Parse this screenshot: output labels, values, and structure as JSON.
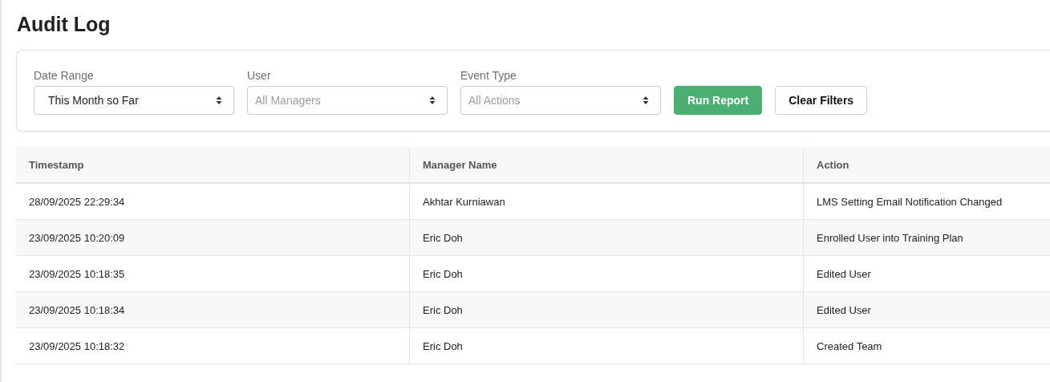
{
  "page": {
    "title": "Audit Log"
  },
  "filters": [
    {
      "label": "Date Range",
      "value": "This Month so Far"
    },
    {
      "label": "User",
      "placeholder": "All Managers"
    },
    {
      "label": "Event Type",
      "placeholder": "All Actions"
    }
  ],
  "buttons": [
    {
      "label": "Run Report",
      "kind": "primary"
    },
    {
      "label": "Clear Filters",
      "kind": "secondary"
    }
  ],
  "table": {
    "columns": [
      "Timestamp",
      "Manager Name",
      "Action"
    ],
    "rows": [
      [
        "28/09/2025 22:29:34",
        "Akhtar Kurniawan",
        "LMS Setting Email Notification Changed"
      ],
      [
        "23/09/2025 10:20:09",
        "Eric Doh",
        "Enrolled User into Training Plan"
      ],
      [
        "23/09/2025 10:18:35",
        "Eric Doh",
        "Edited User"
      ],
      [
        "23/09/2025 10:18:34",
        "Eric Doh",
        "Edited User"
      ],
      [
        "23/09/2025 10:18:32",
        "Eric Doh",
        "Created Team"
      ]
    ]
  }
}
